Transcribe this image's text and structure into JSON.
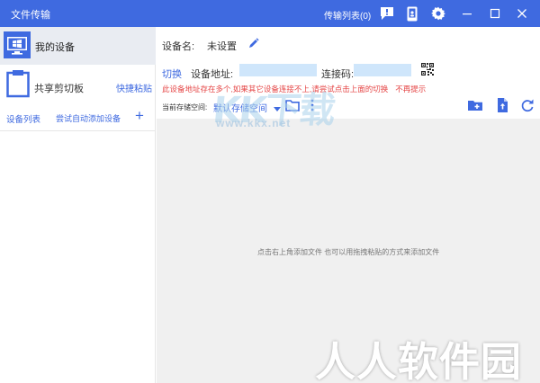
{
  "titlebar": {
    "title": "文件传输",
    "transfer_queue": "传输列表(0)",
    "icons": [
      "message-icon",
      "phone-icon",
      "settings-icon",
      "minimize-icon",
      "maximize-icon",
      "close-icon"
    ]
  },
  "sidebar": {
    "my_device": "我的设备",
    "shared_clipboard": "共享剪切板",
    "quick_paste": "快捷粘贴",
    "device_list": "设备列表",
    "auto_add": "尝试自动添加设备",
    "add_symbol": "+"
  },
  "main": {
    "device_name_label": "设备名:",
    "device_name_value": "未设置",
    "switch": "切换",
    "address_label": "设备地址:",
    "code_label": "连接码:",
    "warning": "此设备地址存在多个,如果其它设备连接不上,请尝试点击上面的切换",
    "warning_tip": "不再提示",
    "storage_label": "当前存储空间:",
    "storage_value": "默认存储空间",
    "empty_hint": "点击右上角添加文件 也可以用拖拽粘贴的方式来添加文件"
  },
  "watermarks": {
    "kk": "KK下载",
    "url": "www.kkx.net",
    "brand": "人人软件园"
  },
  "colors": {
    "accent": "#3f6ae0",
    "warning": "#e54545",
    "sidebar_selected": "#e9ecf2",
    "file_area": "#f0f0f0"
  }
}
